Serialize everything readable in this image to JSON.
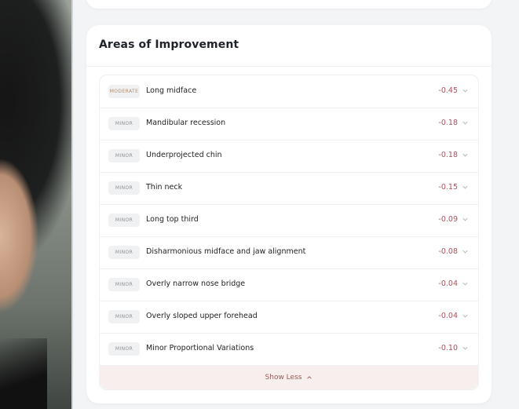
{
  "section": {
    "title": "Areas of Improvement",
    "items": [
      {
        "severity": "MODERATE",
        "label": "Long midface",
        "value": "-0.45"
      },
      {
        "severity": "MINOR",
        "label": "Mandibular recession",
        "value": "-0.18"
      },
      {
        "severity": "MINOR",
        "label": "Underprojected chin",
        "value": "-0.18"
      },
      {
        "severity": "MINOR",
        "label": "Thin neck",
        "value": "-0.15"
      },
      {
        "severity": "MINOR",
        "label": "Long top third",
        "value": "-0.09"
      },
      {
        "severity": "MINOR",
        "label": "Disharmonious midface and jaw alignment",
        "value": "-0.08"
      },
      {
        "severity": "MINOR",
        "label": "Overly narrow nose bridge",
        "value": "-0.04"
      },
      {
        "severity": "MINOR",
        "label": "Overly sloped upper forehead",
        "value": "-0.04"
      },
      {
        "severity": "MINOR",
        "label": "Minor Proportional Variations",
        "value": "-0.10"
      }
    ],
    "toggle_label": "Show Less"
  },
  "colors": {
    "value": "#b0505c",
    "moderate_badge": "#b08a6e",
    "minor_badge": "#8a8f96",
    "toggle_bg": "#f6efed"
  },
  "icons": {
    "row_expand": "chevron-down-icon",
    "toggle": "chevron-up-icon"
  }
}
